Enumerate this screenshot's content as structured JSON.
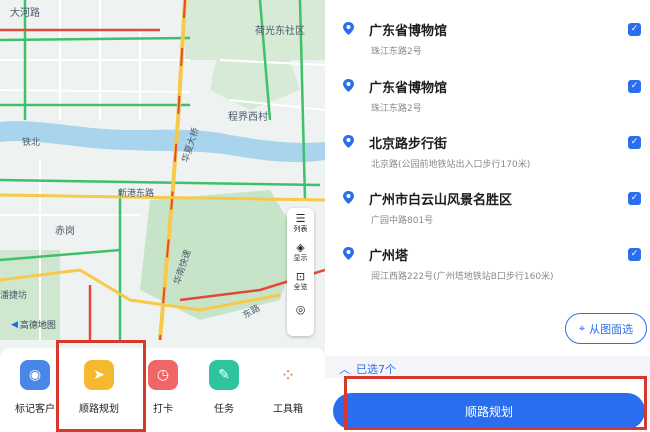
{
  "map": {
    "labels": {
      "dahe_road": "大河路",
      "hexiang_east": "荷光东社区",
      "chengjie_village": "程界西村",
      "huaxia": "华夏大桥",
      "tiebei": "铁北",
      "xingang_east": "新港东路",
      "chigang": "赤岗",
      "huanan_road": "华南快速",
      "lijiao": "潘捷坊",
      "east_road": "东路"
    },
    "tools": [
      {
        "icon": "list-icon",
        "glyph": "☰",
        "label": "列表"
      },
      {
        "icon": "layers-icon",
        "glyph": "◈",
        "label": "显示"
      },
      {
        "icon": "overview-icon",
        "glyph": "⊡",
        "label": "全览"
      },
      {
        "icon": "locate-icon",
        "glyph": "◎",
        "label": ""
      }
    ],
    "logo_text": "高德地图"
  },
  "toolbar": {
    "items": [
      {
        "label": "标记客户",
        "icon": "pin-marker-icon",
        "glyph": "◉",
        "color": "#4a86e8"
      },
      {
        "label": "顺路规划",
        "icon": "navigate-arrow-icon",
        "glyph": "➤",
        "color": "#f5b82e"
      },
      {
        "label": "打卡",
        "icon": "checkin-clock-icon",
        "glyph": "◷",
        "color": "#f06666"
      },
      {
        "label": "任务",
        "icon": "task-clipboard-icon",
        "glyph": "✎",
        "color": "#2ec4a0"
      },
      {
        "label": "工具箱",
        "icon": "toolbox-grid-icon",
        "glyph": "⁘",
        "color": "#ffffff"
      }
    ]
  },
  "pois": [
    {
      "name": "广东省博物馆",
      "address": "珠江东路2号",
      "checked": true
    },
    {
      "name": "广东省博物馆",
      "address": "珠江东路2号",
      "checked": true
    },
    {
      "name": "北京路步行街",
      "address": "北京路(公园前地铁站出入口步行170米)",
      "checked": true
    },
    {
      "name": "广州市白云山风景名胜区",
      "address": "广园中路801号",
      "checked": true
    },
    {
      "name": "广州塔",
      "address": "阅江西路222号(广州塔地铁站B口步行160米)",
      "checked": true
    }
  ],
  "pick_button": {
    "label": "从图面选"
  },
  "selected_count_label": "已选7个",
  "route_button_label": "顺路规划",
  "colors": {
    "accent": "#2a6ef0",
    "highlight": "#d9372b",
    "water": "#a9d4ee",
    "green": "#cfe7cf",
    "road_major": "#f7c94a",
    "road_jam": "#e04a3a",
    "road_flow": "#3fc06a"
  }
}
